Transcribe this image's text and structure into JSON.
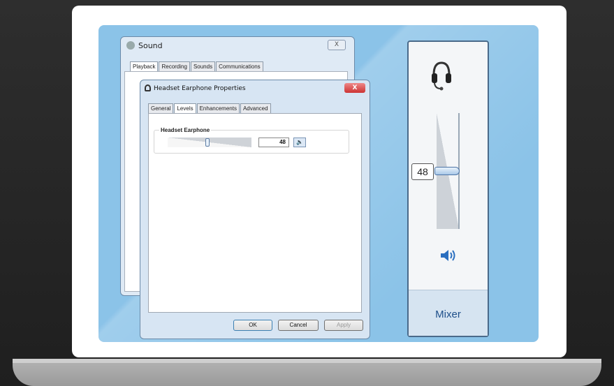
{
  "sound_window": {
    "title": "Sound",
    "close_label": "X",
    "tabs": [
      "Playback",
      "Recording",
      "Sounds",
      "Communications"
    ]
  },
  "properties_window": {
    "title": "Headset Earphone Properties",
    "close_label": "X",
    "tabs": [
      "General",
      "Levels",
      "Enhancements",
      "Advanced"
    ],
    "group_label": "Headset Earphone",
    "level_value": "48",
    "buttons": {
      "ok": "OK",
      "cancel": "Cancel",
      "apply": "Apply"
    }
  },
  "mixer": {
    "volume_value": "48",
    "volume_level": 0.48,
    "label": "Mixer",
    "device_icon": "headset-icon",
    "speaker_icon": "speaker-icon"
  },
  "colors": {
    "panel_blue": "#8bc3e8",
    "mixer_text": "#1e4f8a"
  }
}
